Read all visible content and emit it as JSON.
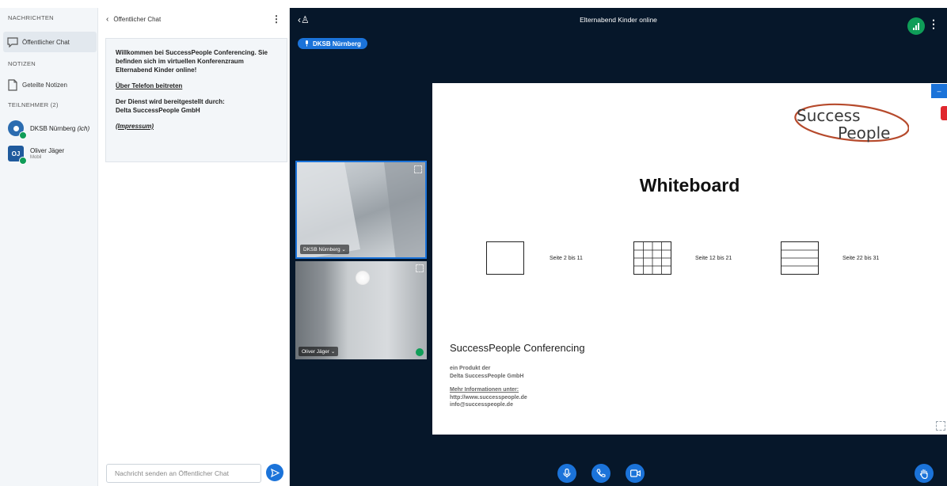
{
  "sidebar": {
    "messages_title": "NACHRICHTEN",
    "public_chat": "Öffentlicher Chat",
    "notes_title": "NOTIZEN",
    "shared_notes": "Geteilte Notizen",
    "participants_title": "TEILNEHMER (2)",
    "users": [
      {
        "name": "DKSB Nürnberg",
        "suffix": "(ich)",
        "initials": ""
      },
      {
        "name": "Oliver Jäger",
        "sub": "Mobil",
        "initials": "OJ"
      }
    ]
  },
  "chat": {
    "header": "Öffentlicher Chat",
    "welcome": "Willkommen bei SuccessPeople Conferencing. Sie befinden sich im virtuellen Konferenzraum Elternabend Kinder online!",
    "phone_link": "Über Telefon beitreten",
    "provided_by_label": "Der Dienst wird bereitgestellt durch:",
    "provider": "Delta SuccessPeople GmbH",
    "impressum": "(Impressum)",
    "input_placeholder": "Nachricht senden an Öffentlicher Chat"
  },
  "meeting": {
    "title": "Elternabend Kinder online",
    "speaker": "DKSB Nürnberg",
    "video_tiles": [
      {
        "name": "DKSB Nürnberg"
      },
      {
        "name": "Oliver Jäger"
      }
    ]
  },
  "slide": {
    "logo_line1": "Success",
    "logo_line2": "People",
    "title": "Whiteboard",
    "options": [
      {
        "label": "Seite 2 bis 11"
      },
      {
        "label": "Seite 12 bis 21"
      },
      {
        "label": "Seite 22 bis 31"
      }
    ],
    "conf_title": "SuccessPeople Conferencing",
    "conf_product": "ein Produkt der",
    "conf_company": "Delta SuccessPeople GmbH",
    "more_info": "Mehr Informationen unter:",
    "url": "http://www.successpeople.de",
    "email": "info@successpeople.de"
  },
  "colors": {
    "accent": "#1b73d9",
    "dark_bg": "#06172a",
    "connection": "#0f9d58",
    "marker": "#e0282e"
  },
  "icons": {
    "chat": "chat-bubble-icon",
    "notes": "document-icon",
    "send": "send-icon",
    "mic": "microphone-icon",
    "phone": "phone-icon",
    "camera": "camera-icon",
    "hand": "hand-raise-icon"
  }
}
